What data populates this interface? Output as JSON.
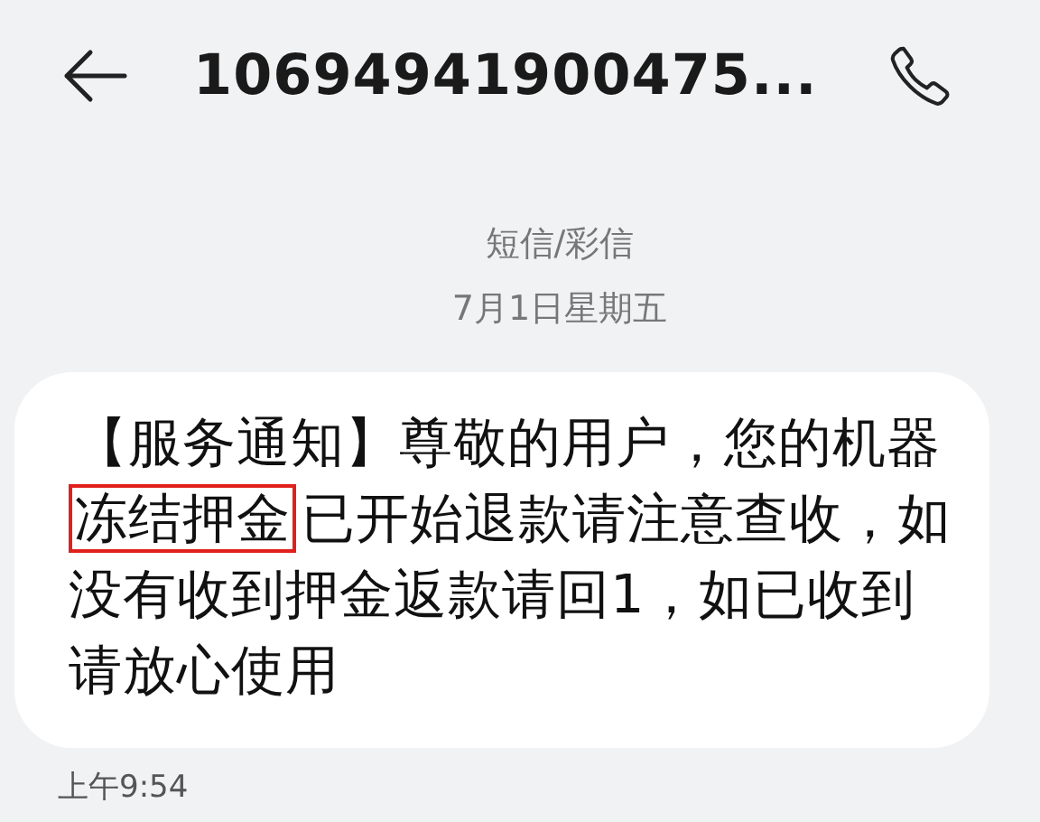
{
  "header": {
    "title": "10694941900475..."
  },
  "conversation": {
    "channel": "短信/彩信",
    "date": "7月1日星期五"
  },
  "message": {
    "segments": [
      {
        "text": "【服务通知】尊敬的用户，您的机器",
        "highlighted": false
      },
      {
        "text": "冻结押金",
        "highlighted": true
      },
      {
        "text": "已开始退款请注意查收，如没有收到押金返款请回1，如已收到请放心使用",
        "highlighted": false
      }
    ],
    "time": "上午9:54"
  }
}
